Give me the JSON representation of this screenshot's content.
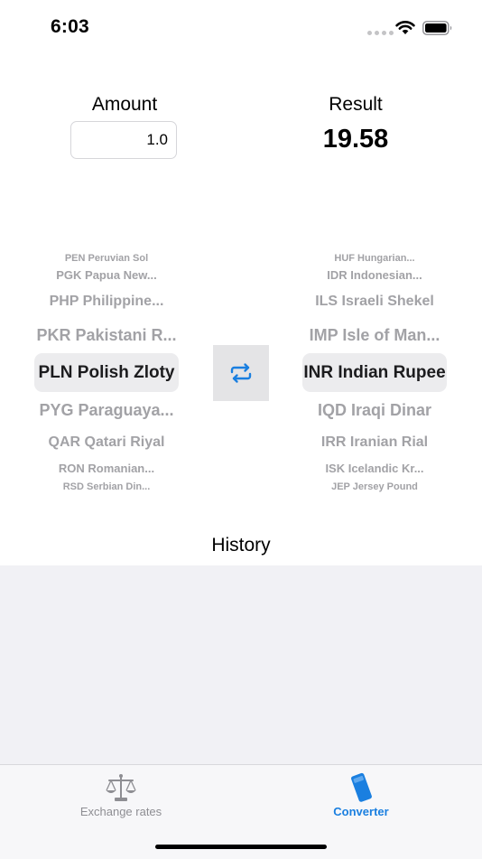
{
  "status_bar": {
    "time": "6:03"
  },
  "amount": {
    "label": "Amount",
    "value": "1.0"
  },
  "result": {
    "label": "Result",
    "value": "19.58"
  },
  "from_picker": {
    "items": [
      "PEN Peruvian Sol",
      "PGK Papua New...",
      "PHP Philippine...",
      "PKR Pakistani R...",
      "PLN Polish Zloty",
      "PYG Paraguaya...",
      "QAR Qatari Riyal",
      "RON Romanian...",
      "RSD Serbian Din..."
    ],
    "selected": "PLN Polish Zloty"
  },
  "to_picker": {
    "items": [
      "HUF Hungarian...",
      "IDR Indonesian...",
      "ILS Israeli Shekel",
      "IMP Isle of Man...",
      "INR Indian Rupee",
      "IQD Iraqi Dinar",
      "IRR Iranian Rial",
      "ISK Icelandic Kr...",
      "JEP Jersey Pound"
    ],
    "selected": "INR Indian Rupee"
  },
  "swap": {
    "icon": "swap-arrows-icon"
  },
  "history": {
    "title": "History"
  },
  "tabs": [
    {
      "label": "Exchange rates",
      "icon": "scales-icon"
    },
    {
      "label": "Converter",
      "icon": "phone-icon"
    }
  ],
  "colors": {
    "accent": "#1a7fe0",
    "history_bg": "#f1f1f5",
    "picker_highlight": "#ececee"
  }
}
